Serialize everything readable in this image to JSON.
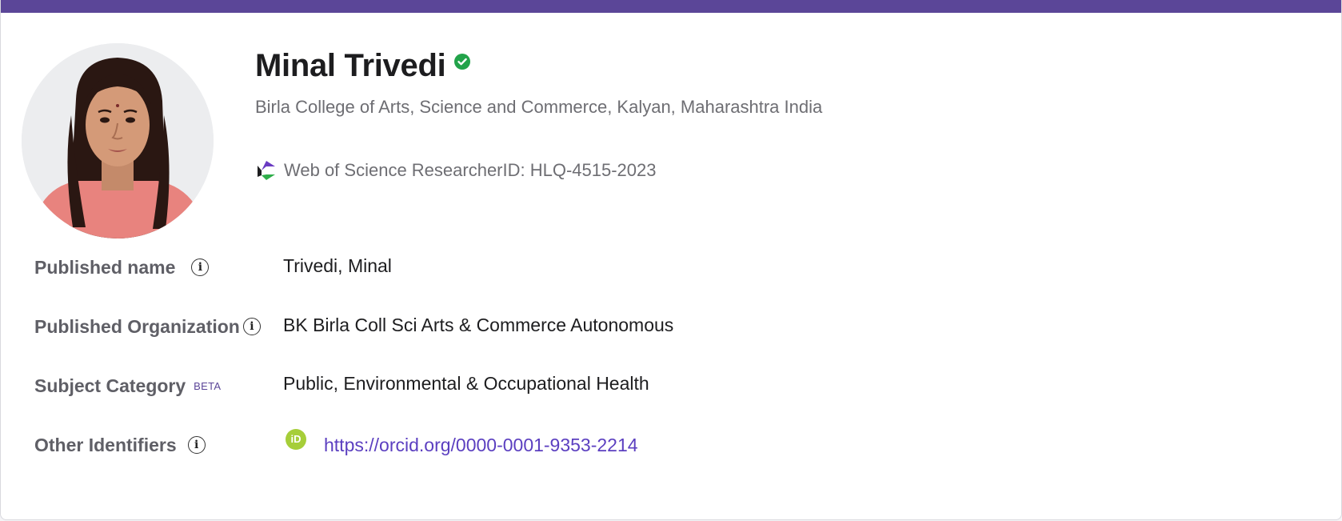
{
  "profile": {
    "name": "Minal Trivedi",
    "affiliation": "Birla College of Arts, Science and Commerce, Kalyan, Maharashtra India",
    "researcher_id_text": "Web of Science ResearcherID: HLQ-4515-2023"
  },
  "fields": {
    "published_name": {
      "label": "Published name",
      "value": "Trivedi, Minal"
    },
    "published_org": {
      "label": "Published Organization",
      "value": "BK Birla Coll Sci Arts & Commerce Autonomous"
    },
    "subject_category": {
      "label": "Subject Category",
      "badge": "BETA",
      "value": "Public, Environmental & Occupational Health"
    },
    "other_identifiers": {
      "label": "Other Identifiers",
      "orcid_icon_text": "iD",
      "orcid_url": "https://orcid.org/0000-0001-9353-2214"
    }
  },
  "icons": {
    "verified": "verified-check-icon",
    "researcher_id": "web-of-science-icon",
    "info": "info-icon",
    "orcid": "orcid-icon",
    "info_glyph": "i"
  },
  "colors": {
    "brand_purple": "#5b4698",
    "verified_green": "#22a34a",
    "link": "#5b3fc0",
    "orcid_green": "#a6ce39"
  }
}
